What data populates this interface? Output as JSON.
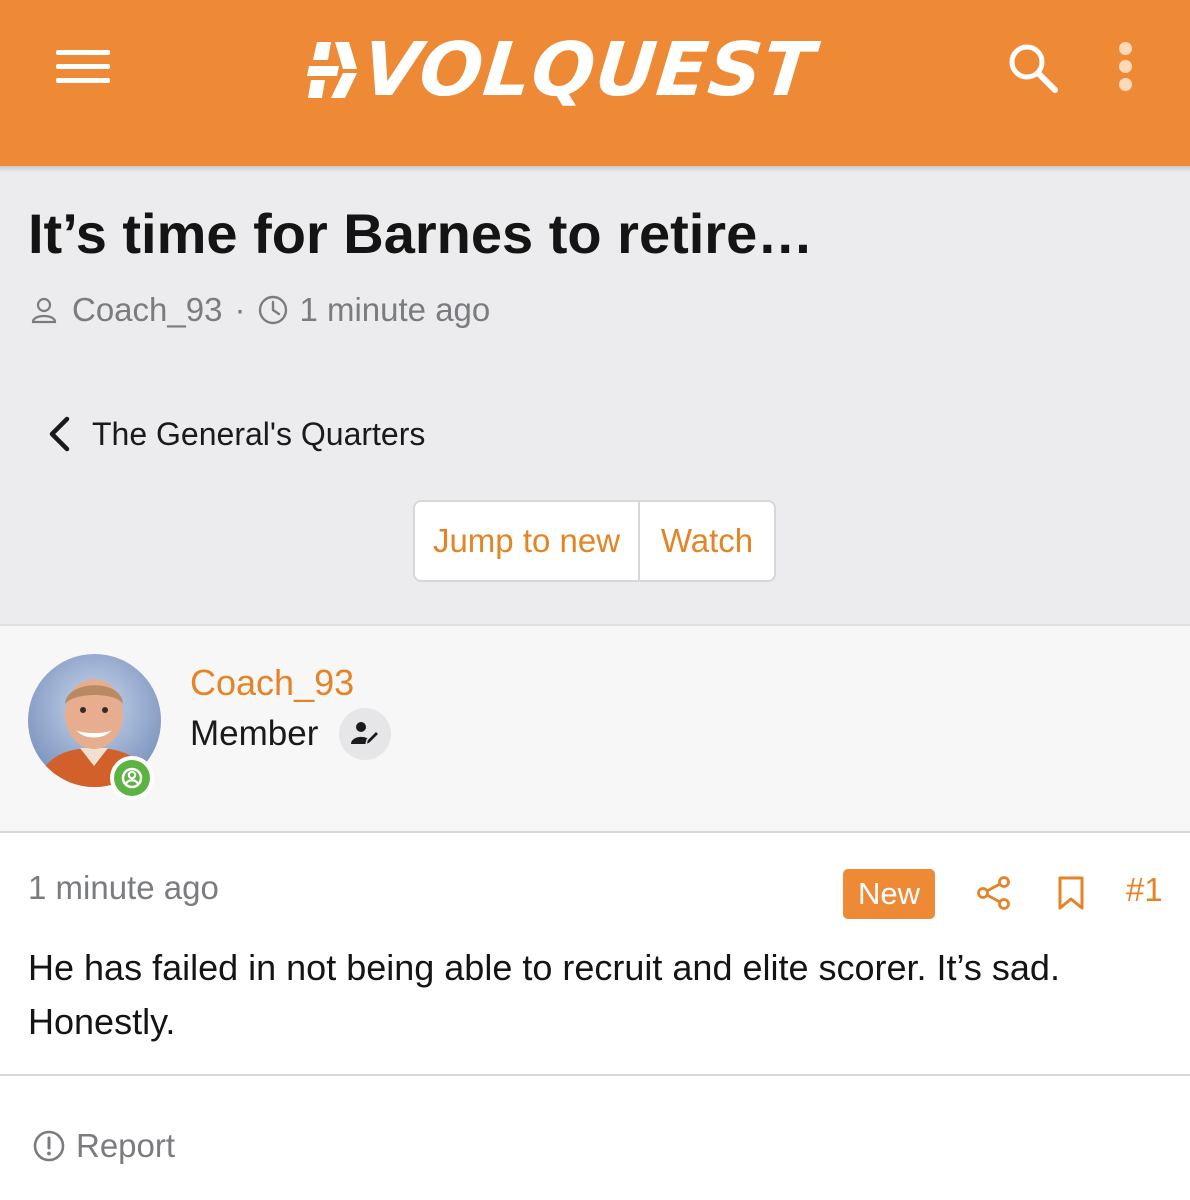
{
  "header": {
    "brand": "VOLQUEST",
    "brand_color": "#ee8a35",
    "menu_icon": "hamburger-icon",
    "search_icon": "search-icon",
    "more_icon": "more-vertical-icon"
  },
  "thread": {
    "title": "It’s time for Barnes to retire…",
    "author": "Coach_93",
    "separator": "·",
    "time": "1 minute ago"
  },
  "breadcrumb": {
    "label": "The General's Quarters"
  },
  "actions": {
    "jump_to_new": "Jump to new",
    "watch": "Watch"
  },
  "post": {
    "author_name": "Coach_93",
    "author_role": "Member",
    "time": "1 minute ago",
    "badge": "New",
    "number": "#1",
    "body": "He has failed in not being able to recruit and elite scorer. It’s sad. Honestly.",
    "online_status_color": "#5db341"
  },
  "footer": {
    "report_label": "Report"
  }
}
